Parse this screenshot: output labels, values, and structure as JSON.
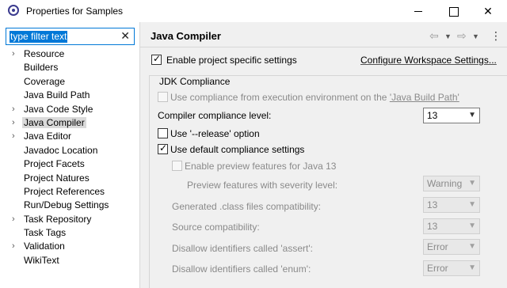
{
  "window": {
    "title": "Properties for Samples",
    "close_glyph": "✕"
  },
  "filter": {
    "value": "type filter text",
    "clear_glyph": "✕"
  },
  "tree": [
    {
      "label": "Resource",
      "expandable": true,
      "selected": false
    },
    {
      "label": "Builders",
      "expandable": false,
      "selected": false
    },
    {
      "label": "Coverage",
      "expandable": false,
      "selected": false
    },
    {
      "label": "Java Build Path",
      "expandable": false,
      "selected": false
    },
    {
      "label": "Java Code Style",
      "expandable": true,
      "selected": false
    },
    {
      "label": "Java Compiler",
      "expandable": true,
      "selected": true
    },
    {
      "label": "Java Editor",
      "expandable": true,
      "selected": false
    },
    {
      "label": "Javadoc Location",
      "expandable": false,
      "selected": false
    },
    {
      "label": "Project Facets",
      "expandable": false,
      "selected": false
    },
    {
      "label": "Project Natures",
      "expandable": false,
      "selected": false
    },
    {
      "label": "Project References",
      "expandable": false,
      "selected": false
    },
    {
      "label": "Run/Debug Settings",
      "expandable": false,
      "selected": false
    },
    {
      "label": "Task Repository",
      "expandable": true,
      "selected": false
    },
    {
      "label": "Task Tags",
      "expandable": false,
      "selected": false
    },
    {
      "label": "Validation",
      "expandable": true,
      "selected": false
    },
    {
      "label": "WikiText",
      "expandable": false,
      "selected": false
    }
  ],
  "page": {
    "title": "Java Compiler",
    "nav_back": "⇦",
    "nav_forward": "⇨",
    "nav_dropdown": "▼",
    "menu_glyph": "⋮",
    "enable_project_specific": {
      "label": "Enable project specific settings",
      "checked": true
    },
    "configure_workspace_link": "Configure Workspace Settings...",
    "jdk_group_title": "JDK Compliance",
    "use_compliance_env": {
      "label_prefix": "Use compliance from execution environment on the ",
      "link": "'Java Build Path'",
      "checked": false
    },
    "compliance_level": {
      "label": "Compiler compliance level:",
      "value": "13"
    },
    "use_release": {
      "label": "Use '--release' option",
      "checked": false
    },
    "use_default_compliance": {
      "label": "Use default compliance settings",
      "checked": true
    },
    "enable_preview": {
      "label": "Enable preview features for Java 13",
      "checked": false
    },
    "preview_severity": {
      "label": "Preview features with severity level:",
      "value": "Warning"
    },
    "generated_class": {
      "label": "Generated .class files compatibility:",
      "value": "13"
    },
    "source_compat": {
      "label": "Source compatibility:",
      "value": "13"
    },
    "disallow_assert": {
      "label": "Disallow identifiers called 'assert':",
      "value": "Error"
    },
    "disallow_enum": {
      "label": "Disallow identifiers called 'enum':",
      "value": "Error"
    }
  },
  "colors": {
    "selection_blue": "#0078d7",
    "panel_bg": "#f0f0f0",
    "disabled_text": "#8a8a8a"
  }
}
